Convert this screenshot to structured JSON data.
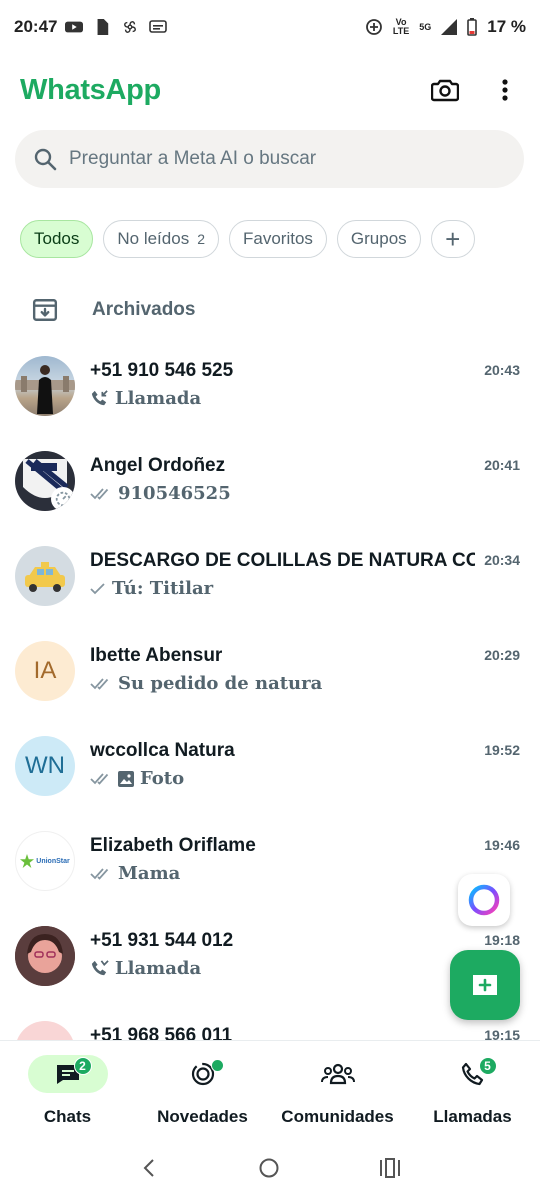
{
  "status_bar": {
    "time": "20:47",
    "battery": "17 %",
    "network_top": "Vo",
    "network_bottom": "LTE",
    "network_gen": "5G"
  },
  "header": {
    "title": "WhatsApp",
    "brand_color": "#1daa61"
  },
  "search": {
    "placeholder": "Preguntar a Meta AI o buscar"
  },
  "filters": [
    {
      "label": "Todos",
      "active": true
    },
    {
      "label": "No leídos",
      "count": "2"
    },
    {
      "label": "Favoritos"
    },
    {
      "label": "Grupos"
    },
    {
      "label": "+"
    }
  ],
  "archived": {
    "label": "Archivados"
  },
  "chats": [
    {
      "name": "+51 910 546 525",
      "time": "20:43",
      "preview": "Llamada",
      "icon": "incoming-call-icon"
    },
    {
      "name": "Angel Ordoñez",
      "time": "20:41",
      "preview": "910546525",
      "icon": "double-check-icon"
    },
    {
      "name": "DESCARGO DE COLILLAS DE NATURA CO",
      "time": "20:34",
      "preview": "Tú: Titilar",
      "icon": "single-check-icon"
    },
    {
      "name": "Ibette Abensur",
      "time": "20:29",
      "preview": "Su pedido de natura",
      "icon": "double-check-icon",
      "initials": "IA"
    },
    {
      "name": "wccollca Natura",
      "time": "19:52",
      "preview": "Foto",
      "icon": "double-check-icon",
      "initials": "WN"
    },
    {
      "name": "Elizabeth Oriflame",
      "time": "19:46",
      "preview": "Mama",
      "icon": "double-check-icon",
      "logo_text": "UnionStar"
    },
    {
      "name": "+51 931 544 012",
      "time": "19:18",
      "preview": "Llamada",
      "icon": "missed-call-icon"
    },
    {
      "name": "+51 968 566 011",
      "time": "19:15"
    }
  ],
  "bottom_nav": [
    {
      "label": "Chats",
      "badge": "2",
      "active": true
    },
    {
      "label": "Novedades"
    },
    {
      "label": "Comunidades"
    },
    {
      "label": "Llamadas",
      "badge": "5"
    }
  ]
}
